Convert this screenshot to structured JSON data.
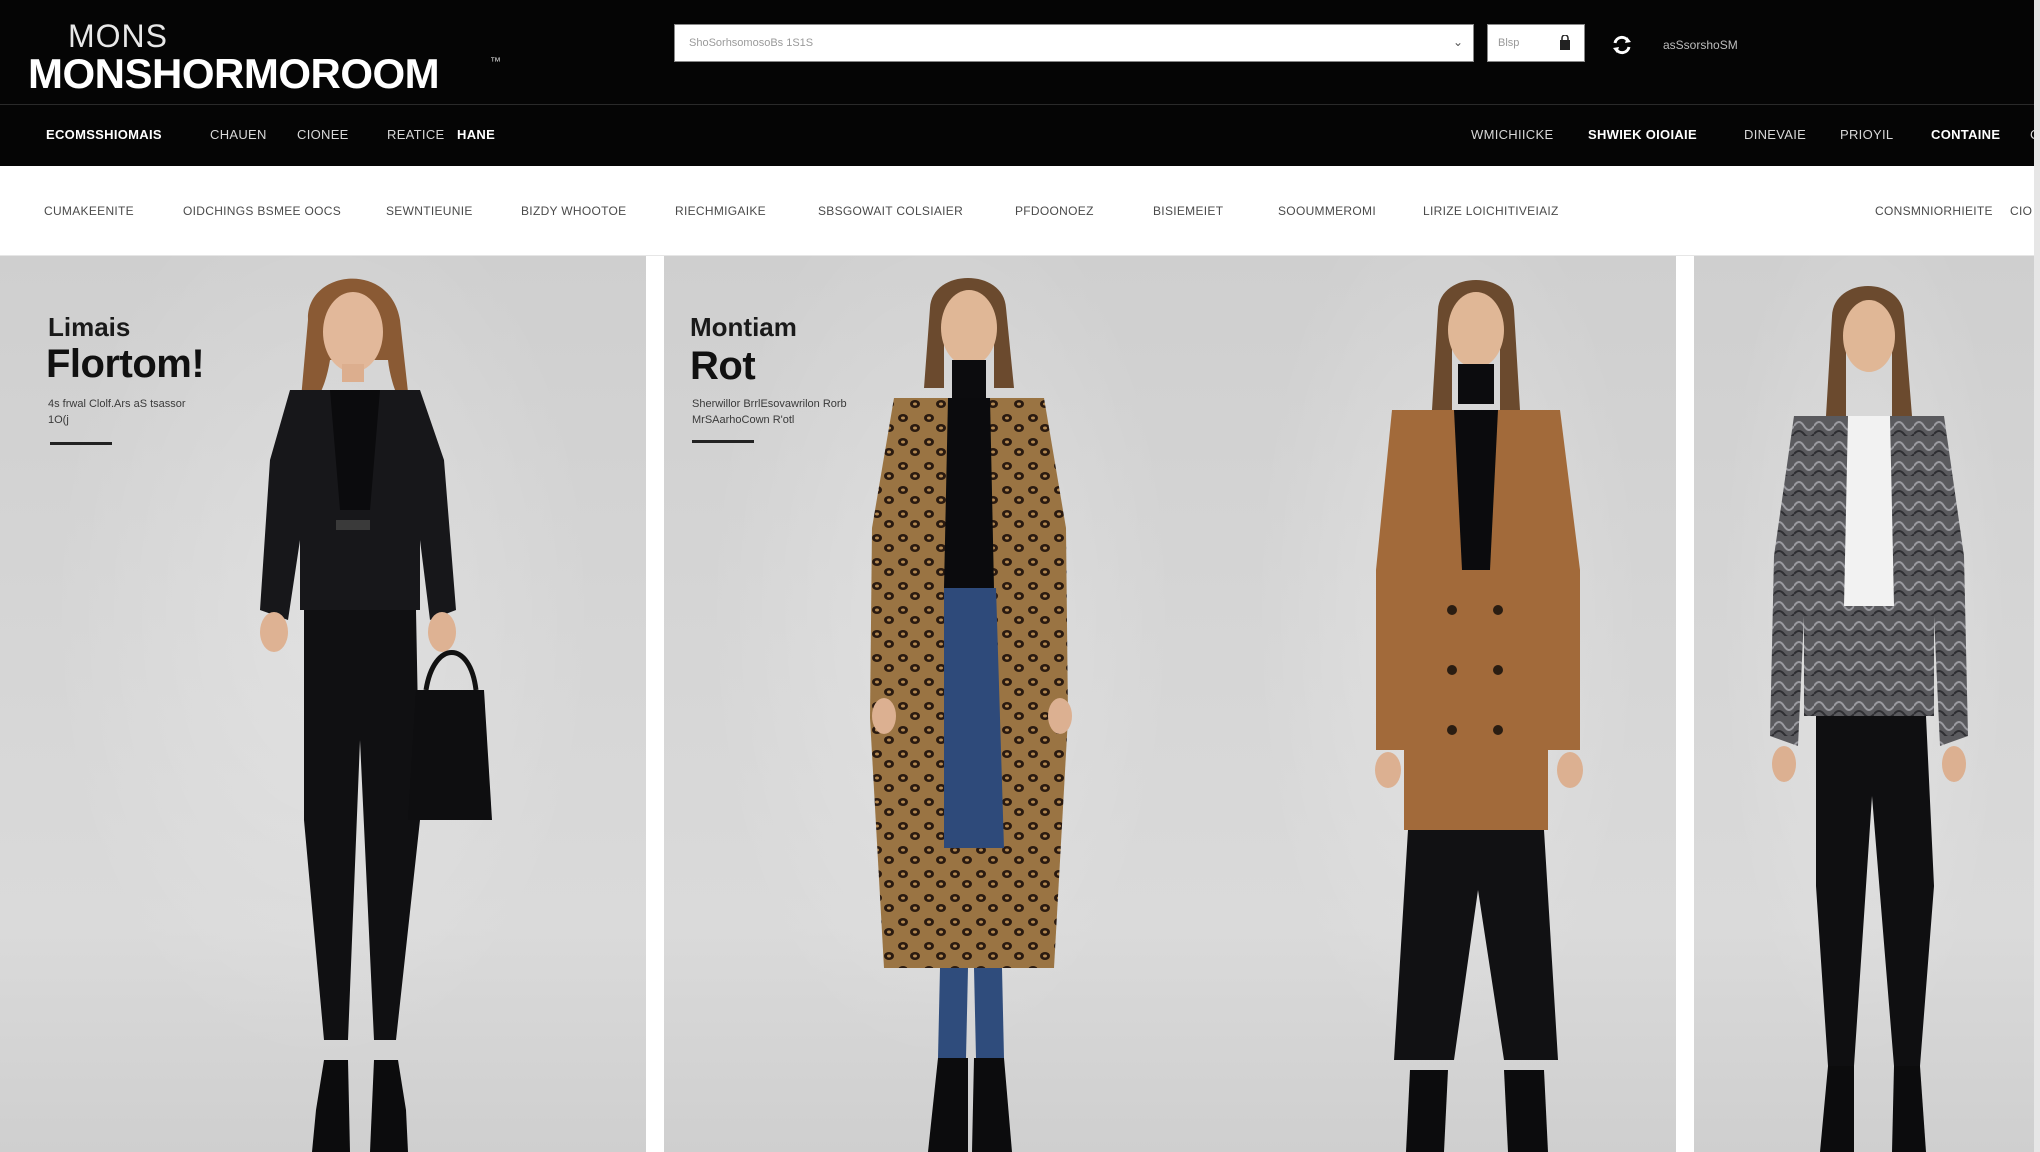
{
  "header": {
    "logo_small": "MONS",
    "logo_main": "MONSHORMOROOM",
    "logo_mark": "™",
    "search_placeholder": "ShoSorhsomosoBs 1S1S",
    "shop_label": "Blsp",
    "account_label": "asSsorshoSM"
  },
  "nav": {
    "left": [
      "ECOMSSHIOMAIS",
      "CHAUEN",
      "CIONEE",
      "REATICE",
      "HANE"
    ],
    "right": [
      "WMICHIICKE",
      "SHWIEK OIOIAIE",
      "DINEVAIE",
      "PRIOYIL",
      "CONTAINE",
      "C"
    ]
  },
  "categories": [
    "CUMAKEENITE",
    "OIDCHINGS BSMEE OOCS",
    "SEWNTIEUNIE",
    "BIZDY WHOOTOE",
    "RIECHMIGAIKE",
    "SBSGOWAIT COLSIAIER",
    "PFDOONOEZ",
    "BISIEMEIET",
    "SOOUMMEROMI",
    "LIRIZE LOICHITIVEIAIZ",
    "CONSMNIORHIEITE",
    "CIO"
  ],
  "promos": [
    {
      "sub": "Limais",
      "title": "Flortom!",
      "desc": "4s frwal Clolf.Ars aS tsassor 1O(j"
    },
    {
      "sub": "Montiam",
      "title": "Rot",
      "desc": "Sherwillor BrrlEsovawrilon Rorb MrSAarhoCown R'otl"
    }
  ],
  "colors": {
    "header_bg": "#050505",
    "panel_bg": "#d4d4d4",
    "accent": "#ffffff"
  },
  "icons": [
    "cart-icon",
    "sync-icon",
    "chevron-down-icon"
  ]
}
